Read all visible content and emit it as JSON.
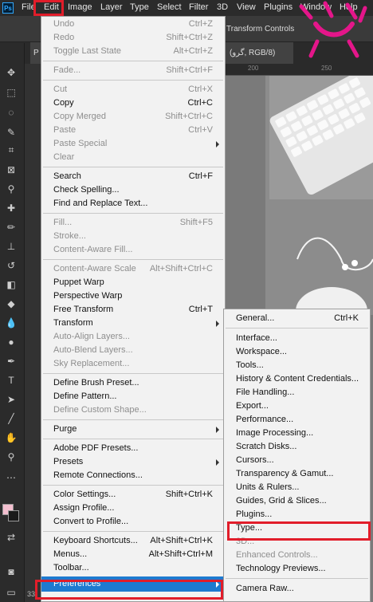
{
  "menubar": {
    "items": [
      "File",
      "Edit",
      "Image",
      "Layer",
      "Type",
      "Select",
      "Filter",
      "3D",
      "View",
      "Plugins",
      "Window",
      "Help"
    ]
  },
  "options": {
    "transform_controls": "Transform Controls"
  },
  "document": {
    "tab_label_left": "P",
    "tab_label_right": "(گرو, RGB/8)",
    "ruler": [
      "200",
      "250"
    ],
    "zoom": "33"
  },
  "edit_menu": {
    "groups": [
      [
        {
          "label": "Undo",
          "shortcut": "Ctrl+Z",
          "disabled": true
        },
        {
          "label": "Redo",
          "shortcut": "Shift+Ctrl+Z",
          "disabled": true
        },
        {
          "label": "Toggle Last State",
          "shortcut": "Alt+Ctrl+Z",
          "disabled": true
        }
      ],
      [
        {
          "label": "Fade...",
          "shortcut": "Shift+Ctrl+F",
          "disabled": true
        }
      ],
      [
        {
          "label": "Cut",
          "shortcut": "Ctrl+X",
          "disabled": true
        },
        {
          "label": "Copy",
          "shortcut": "Ctrl+C",
          "disabled": false
        },
        {
          "label": "Copy Merged",
          "shortcut": "Shift+Ctrl+C",
          "disabled": true
        },
        {
          "label": "Paste",
          "shortcut": "Ctrl+V",
          "disabled": true
        },
        {
          "label": "Paste Special",
          "shortcut": "",
          "disabled": true,
          "submenu": true
        },
        {
          "label": "Clear",
          "shortcut": "",
          "disabled": true
        }
      ],
      [
        {
          "label": "Search",
          "shortcut": "Ctrl+F",
          "disabled": false
        },
        {
          "label": "Check Spelling...",
          "shortcut": "",
          "disabled": false
        },
        {
          "label": "Find and Replace Text...",
          "shortcut": "",
          "disabled": false
        }
      ],
      [
        {
          "label": "Fill...",
          "shortcut": "Shift+F5",
          "disabled": true
        },
        {
          "label": "Stroke...",
          "shortcut": "",
          "disabled": true
        },
        {
          "label": "Content-Aware Fill...",
          "shortcut": "",
          "disabled": true
        }
      ],
      [
        {
          "label": "Content-Aware Scale",
          "shortcut": "Alt+Shift+Ctrl+C",
          "disabled": true
        },
        {
          "label": "Puppet Warp",
          "shortcut": "",
          "disabled": false
        },
        {
          "label": "Perspective Warp",
          "shortcut": "",
          "disabled": false
        },
        {
          "label": "Free Transform",
          "shortcut": "Ctrl+T",
          "disabled": false
        },
        {
          "label": "Transform",
          "shortcut": "",
          "disabled": false,
          "submenu": true
        },
        {
          "label": "Auto-Align Layers...",
          "shortcut": "",
          "disabled": true
        },
        {
          "label": "Auto-Blend Layers...",
          "shortcut": "",
          "disabled": true
        },
        {
          "label": "Sky Replacement...",
          "shortcut": "",
          "disabled": true
        }
      ],
      [
        {
          "label": "Define Brush Preset...",
          "shortcut": "",
          "disabled": false
        },
        {
          "label": "Define Pattern...",
          "shortcut": "",
          "disabled": false
        },
        {
          "label": "Define Custom Shape...",
          "shortcut": "",
          "disabled": true
        }
      ],
      [
        {
          "label": "Purge",
          "shortcut": "",
          "disabled": false,
          "submenu": true
        }
      ],
      [
        {
          "label": "Adobe PDF Presets...",
          "shortcut": "",
          "disabled": false
        },
        {
          "label": "Presets",
          "shortcut": "",
          "disabled": false,
          "submenu": true
        },
        {
          "label": "Remote Connections...",
          "shortcut": "",
          "disabled": false
        }
      ],
      [
        {
          "label": "Color Settings...",
          "shortcut": "Shift+Ctrl+K",
          "disabled": false
        },
        {
          "label": "Assign Profile...",
          "shortcut": "",
          "disabled": false
        },
        {
          "label": "Convert to Profile...",
          "shortcut": "",
          "disabled": false
        }
      ],
      [
        {
          "label": "Keyboard Shortcuts...",
          "shortcut": "Alt+Shift+Ctrl+K",
          "disabled": false
        },
        {
          "label": "Menus...",
          "shortcut": "Alt+Shift+Ctrl+M",
          "disabled": false
        },
        {
          "label": "Toolbar...",
          "shortcut": "",
          "disabled": false
        },
        {
          "label": "Preferences",
          "shortcut": "",
          "disabled": false,
          "submenu": true,
          "highlighted": true
        }
      ]
    ]
  },
  "preferences_menu": {
    "groups": [
      [
        {
          "label": "General...",
          "shortcut": "Ctrl+K",
          "disabled": false
        }
      ],
      [
        {
          "label": "Interface...",
          "disabled": false
        },
        {
          "label": "Workspace...",
          "disabled": false
        },
        {
          "label": "Tools...",
          "disabled": false
        },
        {
          "label": "History & Content Credentials...",
          "disabled": false
        },
        {
          "label": "File Handling...",
          "disabled": false
        },
        {
          "label": "Export...",
          "disabled": false
        },
        {
          "label": "Performance...",
          "disabled": false
        },
        {
          "label": "Image Processing...",
          "disabled": false
        },
        {
          "label": "Scratch Disks...",
          "disabled": false
        },
        {
          "label": "Cursors...",
          "disabled": false
        },
        {
          "label": "Transparency & Gamut...",
          "disabled": false
        },
        {
          "label": "Units & Rulers...",
          "disabled": false
        },
        {
          "label": "Guides, Grid & Slices...",
          "disabled": false
        },
        {
          "label": "Plugins...",
          "disabled": false
        },
        {
          "label": "Type...",
          "disabled": false
        },
        {
          "label": "3D...",
          "disabled": true
        },
        {
          "label": "Enhanced Controls...",
          "disabled": true
        },
        {
          "label": "Technology Previews...",
          "disabled": false
        }
      ],
      [
        {
          "label": "Camera Raw...",
          "disabled": false
        }
      ]
    ]
  },
  "colors": {
    "highlight_red": "#e11d2a",
    "selection_blue": "#1e7ad0",
    "logo_magenta": "#e4168a"
  }
}
